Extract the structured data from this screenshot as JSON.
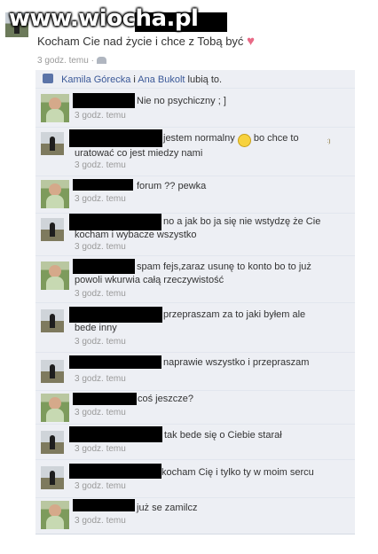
{
  "watermark": "www.wiocha.pl",
  "post": {
    "text": "Kocham Cie nad życie i chce z Tobą być",
    "heart": "♥",
    "time": "3 godz. temu",
    "separator": "·",
    "audience_icon": "friends-icon"
  },
  "likes": {
    "name1": "Kamila Górecka",
    "conj": " i ",
    "name2": "Ana Bukolt",
    "suffix": " lubią to."
  },
  "comments": [
    {
      "author": "female",
      "text": "Nie no psychiczny ; ]",
      "time": "3 godz. temu"
    },
    {
      "author": "male",
      "text_before": "jestem normalny ",
      "emoticon": ":)",
      "text_after": " bo chce to uratować co jest miedzy nami",
      "time": "3 godz. temu"
    },
    {
      "author": "female",
      "text": "forum ?? pewka",
      "time": "3 godz. temu"
    },
    {
      "author": "male",
      "text": "no a jak bo ja się nie wstydzę że Cie kocham i wybacze wszystko",
      "time": "3 godz. temu"
    },
    {
      "author": "female",
      "text": "spam fejs,zaraz usunę to konto bo to już powoli wkurwia całą rzeczywistość",
      "time": "3 godz. temu"
    },
    {
      "author": "male",
      "text": "przepraszam za to jaki byłem ale bede inny",
      "time": "3 godz. temu"
    },
    {
      "author": "male",
      "text": "naprawie wszystko i przepraszam",
      "time": "3 godz. temu"
    },
    {
      "author": "female",
      "text": "coś jeszcze?",
      "time": "3 godz. temu"
    },
    {
      "author": "male",
      "text": "tak bede się o Ciebie starał",
      "time": "3 godz. temu"
    },
    {
      "author": "male",
      "text": "kocham Cię i tylko ty w moim sercu",
      "time": "3 godz. temu"
    },
    {
      "author": "female",
      "text": "już se zamilcz",
      "time": "3 godz. temu"
    }
  ]
}
